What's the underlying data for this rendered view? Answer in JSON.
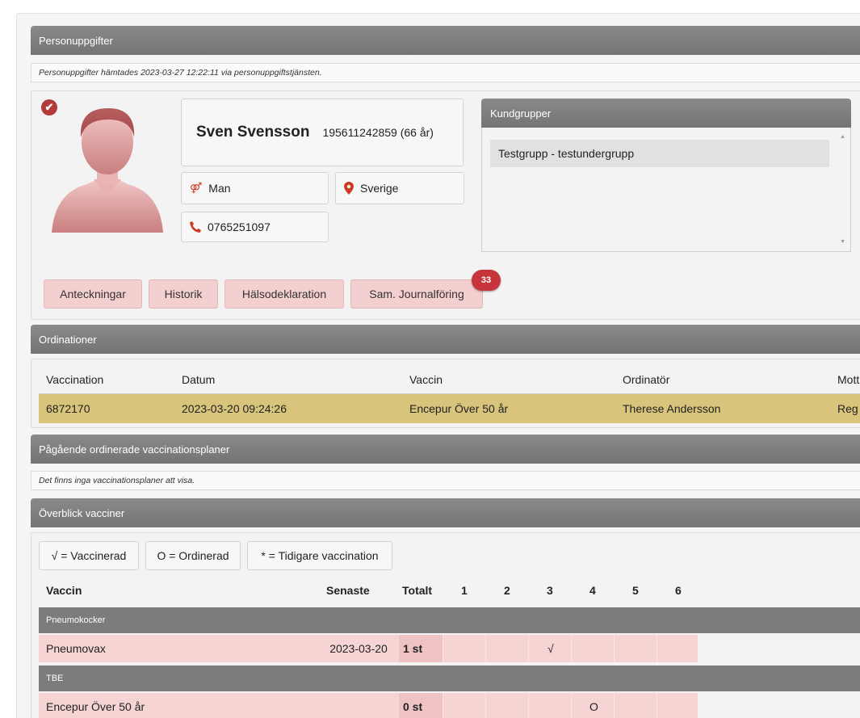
{
  "sections": {
    "personuppgifter": "Personuppgifter",
    "ordinationer": "Ordinationer",
    "planer": "Pågående ordinerade vaccinationsplaner",
    "overblick": "Överblick vacciner"
  },
  "notes": {
    "fetched": "Personuppgifter hämtades 2023-03-27 12:22:11 via personuppgiftstjänsten.",
    "no_plans": "Det finns inga vaccinationsplaner att visa."
  },
  "person": {
    "name": "Sven Svensson",
    "id": "195611242859 (66 år)",
    "gender": "Man",
    "country": "Sverige",
    "phone": "0765251097",
    "check_icon": "✔"
  },
  "kundgrupper": {
    "title": "Kundgrupper",
    "items": [
      "Testgrupp - testundergrupp"
    ]
  },
  "tabs": [
    {
      "label": "Anteckningar"
    },
    {
      "label": "Historik"
    },
    {
      "label": "Hälsodeklaration"
    },
    {
      "label": "Sam. Journalföring"
    }
  ],
  "badge_count": "33",
  "ordinations": {
    "headers": [
      "Vaccination",
      "Datum",
      "Vaccin",
      "Ordinatör",
      "Mott"
    ],
    "rows": [
      [
        "6872170",
        "2023-03-20 09:24:26",
        "Encepur Över 50 år",
        "Therese Andersson",
        "Reg"
      ]
    ]
  },
  "legend": [
    "√ = Vaccinerad",
    "O = Ordinerad",
    "* = Tidigare vaccination"
  ],
  "vaccine_table": {
    "headers": [
      "Vaccin",
      "Senaste",
      "Totalt",
      "1",
      "2",
      "3",
      "4",
      "5",
      "6"
    ],
    "groups": [
      {
        "name": "Pneumokocker",
        "rows": [
          {
            "vaccin": "Pneumovax",
            "senaste": "2023-03-20",
            "totalt": "1 st",
            "doses": [
              "",
              "",
              "√",
              "",
              "",
              ""
            ]
          }
        ]
      },
      {
        "name": "TBE",
        "rows": [
          {
            "vaccin": "Encepur Över 50 år",
            "senaste": "",
            "totalt": "0 st",
            "doses": [
              "",
              "",
              "",
              "O",
              "",
              ""
            ]
          }
        ]
      }
    ]
  },
  "colors": {
    "accent_red": "#c8343b",
    "header_gray": "#7c7c7c",
    "button_pink": "#f4cfd0",
    "highlight_row": "#d8c47a"
  }
}
